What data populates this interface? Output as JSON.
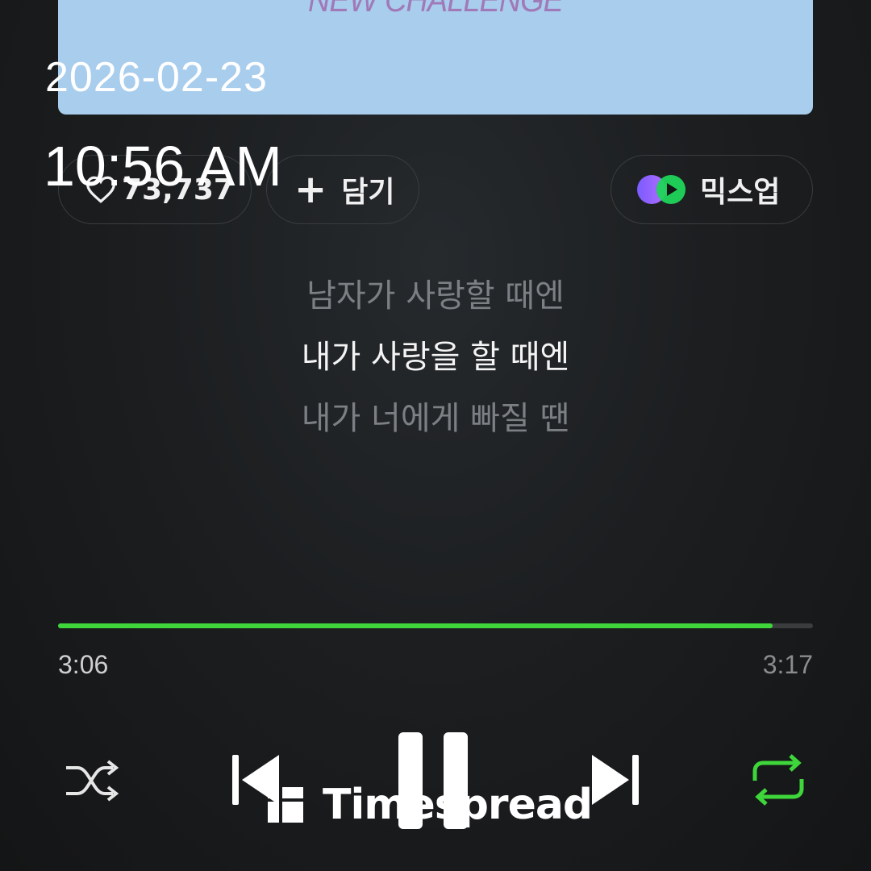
{
  "album": {
    "art_text": "NEW CHALLENGE"
  },
  "overlay": {
    "date": "2026-02-23",
    "time": "10:56 AM"
  },
  "actions": {
    "like_count": "73,737",
    "add_label": "담기",
    "mixup_label": "믹스업"
  },
  "lyrics": {
    "previous": "남자가 사랑할 때엔",
    "current": "내가 사랑을 할 때엔",
    "next": "내가 너에게 빠질 땐"
  },
  "playback": {
    "elapsed": "3:06",
    "duration": "3:17",
    "progress_fraction": 0.947,
    "is_playing": true,
    "repeat_on": true,
    "shuffle_on": false
  },
  "icons": {
    "like": "heart-outline-icon",
    "add": "plus-icon",
    "mixup": "mixup-logo-icon",
    "shuffle": "shuffle-icon",
    "previous": "skip-previous-icon",
    "pause": "pause-icon",
    "next": "skip-next-icon",
    "repeat": "repeat-icon"
  },
  "colors": {
    "accent": "#3ed63a",
    "album_bg": "#a9cdec"
  },
  "watermark": {
    "text": "Timespread"
  }
}
